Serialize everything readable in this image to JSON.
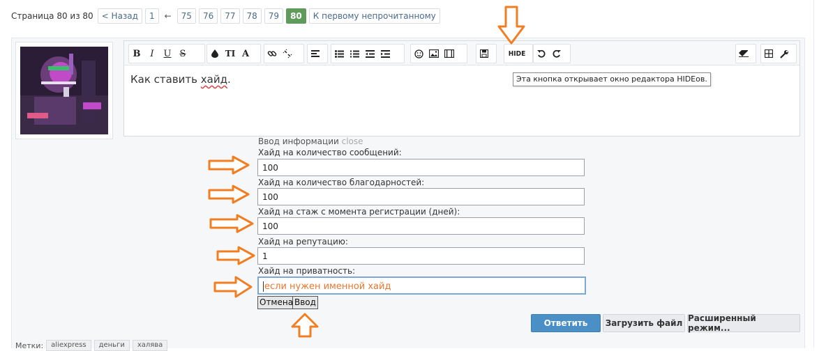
{
  "pagination": {
    "label": "Страница 80 из 80",
    "prev": "< Назад",
    "first": "1",
    "ellipsis_arrow": "←",
    "pages": [
      "75",
      "76",
      "77",
      "78",
      "79"
    ],
    "current": "80",
    "first_unread": "К первому непрочитанному"
  },
  "toolbar": {
    "bold": "B",
    "italic": "I",
    "underline": "U",
    "strike": "S",
    "color_icon": "droplet-icon",
    "size": "TI",
    "font": "A",
    "hide_label": "HIDE"
  },
  "editor": {
    "text_before": "Как ставить ",
    "text_misspelled": "хайд",
    "text_after": "."
  },
  "tooltip": "Эта кнопка открывает окно редактора HIDEов.",
  "form": {
    "title": "Ввод информации",
    "close_label": "close",
    "fields": [
      {
        "label": "Хайд на количество сообщений:",
        "value": "100"
      },
      {
        "label": "Хайд на количество благодарностей:",
        "value": "100"
      },
      {
        "label": "Хайд на стаж с момента регистрации (дней):",
        "value": "100"
      },
      {
        "label": "Хайд на репутацию:",
        "value": "1"
      },
      {
        "label": "Хайд на приватность:",
        "value": "если нужен именной хайд"
      }
    ],
    "cancel": "Отмена",
    "submit": "Ввод"
  },
  "buttons": {
    "reply": "Ответить",
    "upload": "Загрузить файл",
    "advanced": "Расширенный режим..."
  },
  "tags": {
    "label": "Метки:",
    "items": [
      "aliexpress",
      "деньги",
      "халява"
    ]
  },
  "colors": {
    "arrow": "#f07f24",
    "current_page": "#5f9b5a",
    "primary_button": "#4a8fc6"
  }
}
